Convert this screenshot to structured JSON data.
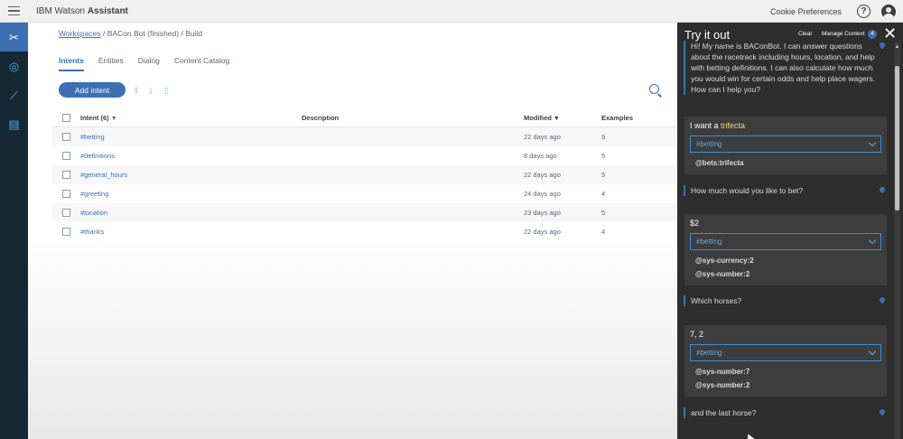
{
  "app": {
    "brand_prefix": "IBM Watson",
    "brand_name": "Assistant"
  },
  "topbar": {
    "cookie_label": "Cookie Preferences",
    "help_label": "?"
  },
  "leftnav": {
    "items": [
      "skills-icon",
      "assistants-icon",
      "analytics-icon",
      "catalog-icon"
    ]
  },
  "breadcrumb": {
    "workspaces": "Workspaces",
    "rest": "/ BACon Bot (finished) / Build"
  },
  "tabs": [
    {
      "label": "Intents",
      "active": true
    },
    {
      "label": "Entities",
      "active": false
    },
    {
      "label": "Dialog",
      "active": false
    },
    {
      "label": "Content Catalog",
      "active": false
    }
  ],
  "toolbar": {
    "add_label": "Add intent"
  },
  "table": {
    "headers": {
      "intent": "Intent (6)",
      "description": "Description",
      "modified": "Modified",
      "examples": "Examples"
    },
    "rows": [
      {
        "intent": "#betting",
        "description": "",
        "modified": "22 days ago",
        "examples": "9"
      },
      {
        "intent": "#definitions",
        "description": "",
        "modified": "8 days ago",
        "examples": "5"
      },
      {
        "intent": "#general_hours",
        "description": "",
        "modified": "22 days ago",
        "examples": "5"
      },
      {
        "intent": "#greeting",
        "description": "",
        "modified": "24 days ago",
        "examples": "4"
      },
      {
        "intent": "#location",
        "description": "",
        "modified": "23 days ago",
        "examples": "5"
      },
      {
        "intent": "#thanks",
        "description": "",
        "modified": "22 days ago",
        "examples": "4"
      }
    ]
  },
  "panel": {
    "title": "Try it out",
    "clear_label": "Clear",
    "context_label": "Manage Context",
    "context_count": "4",
    "close_label": "✕",
    "welcome": "Hi! My name is BAConBot. I can answer questions about the racetrack including hours, location, and help with betting definitions. I can also calculate how much you would win for certain odds and help place wagers. How can I help you?",
    "exchanges": [
      {
        "user_prefix": "I want a ",
        "user_highlight": "trifecta",
        "intent": "#betting",
        "entities": [
          "@bets:trifecta"
        ],
        "reply": "How much would you like to bet?"
      },
      {
        "user_prefix": "$2",
        "user_highlight": "",
        "intent": "#betting",
        "entities": [
          "@sys-currency:2",
          "@sys-number:2"
        ],
        "reply": "Which horses?"
      },
      {
        "user_prefix": "7, 2",
        "user_highlight": "",
        "intent": "#betting",
        "entities": [
          "@sys-number:7",
          "@sys-number:2"
        ],
        "reply": "and the last horse?"
      }
    ]
  },
  "colors": {
    "accent": "#3d70b2",
    "nav_bg": "#152935",
    "panel_bg": "#2e2e2e",
    "highlight": "#f2d58e"
  }
}
